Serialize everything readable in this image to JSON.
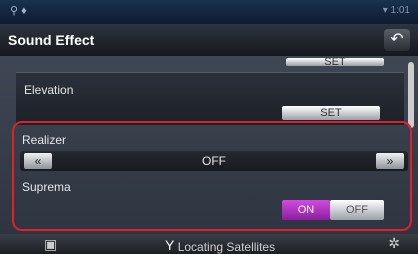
{
  "status_bar": {
    "left_icons": "⚲ ♦",
    "right_icons": "▾ 1:01"
  },
  "title_bar": {
    "title": "Sound Effect",
    "back_symbol": "↶"
  },
  "rows": {
    "set_partial_label": "SET",
    "elevation_label": "Elevation",
    "elevation_set_label": "SET",
    "realizer_label": "Realizer",
    "realizer_left": "«",
    "realizer_value": "OFF",
    "realizer_right": "»",
    "suprema_label": "Suprema",
    "suprema_on": "ON",
    "suprema_off": "OFF"
  },
  "bottom_bar": {
    "status": "Locating Satellites"
  },
  "colors": {
    "highlight": "#e0202a",
    "toggle_on": "#c13ad0"
  }
}
